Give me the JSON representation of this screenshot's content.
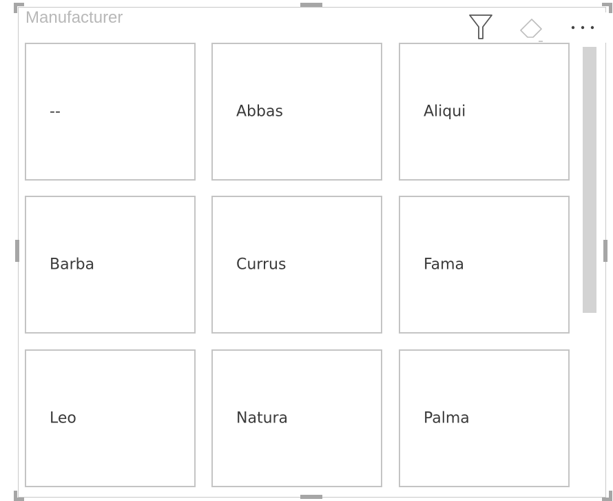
{
  "slicer": {
    "title": "Manufacturer",
    "header_icons": [
      "filter-icon",
      "eraser-icon",
      "more-options-icon"
    ],
    "items": [
      {
        "label": "--"
      },
      {
        "label": "Abbas"
      },
      {
        "label": "Aliqui"
      },
      {
        "label": "Barba"
      },
      {
        "label": "Currus"
      },
      {
        "label": "Fama"
      },
      {
        "label": "Leo"
      },
      {
        "label": "Natura"
      },
      {
        "label": "Palma"
      }
    ]
  },
  "colors": {
    "tile_border": "#c4c4c4",
    "title": "#b8b8b8",
    "text": "#3a3a3a",
    "scrollbar": "#d3d3d3"
  }
}
